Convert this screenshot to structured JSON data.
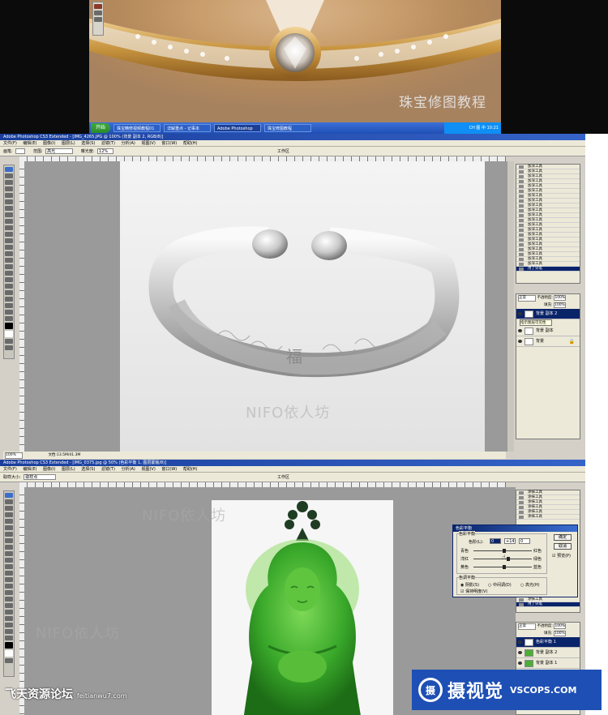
{
  "video": {
    "caption": "珠宝修图教程",
    "start_button": "开始",
    "taskbar_items": [
      "珠宝精修视频教程01",
      "详解重点 - 记事本",
      "Adobe Photoshop",
      "珠宝修图教程"
    ],
    "active_task_index": 2,
    "tray_text": "CH 图 中 10:21"
  },
  "ps1": {
    "title": "Adobe Photoshop CS3 Extended - [IMG_4265.JPG @ 100% (背景 副本 2, RGB/8)]",
    "menu": [
      "文件(F)",
      "编辑(E)",
      "图像(I)",
      "图层(L)",
      "选择(S)",
      "滤镜(T)",
      "分析(A)",
      "视图(V)",
      "窗口(W)",
      "帮助(H)"
    ],
    "options": {
      "brush_label": "画笔:",
      "range_label": "范围:",
      "range_value": "高光",
      "exposure_label": "曝光度:",
      "exposure_value": "12%",
      "workspace": "工作区"
    },
    "watermark": "NIFO依人坊",
    "history_item_label": "加深工具",
    "history_last": "用了尖笔",
    "layers": {
      "mode": "正常",
      "opacity_label": "不透明度:",
      "opacity": "100%",
      "fill_label": "填充:",
      "fill": "100%",
      "rows": [
        "背景 副本 2",
        "背景 副本",
        "背景"
      ],
      "selected": 0,
      "tooltip": "指示图层可见性"
    },
    "status_zoom": "100%",
    "status_doc": "文档:13.5M/41.3M"
  },
  "ps2": {
    "title": "Adobe Photoshop CS3 Extended - [IMG_0375.jpg @ 50% (色彩平衡 1, 图层蒙版/8)]",
    "menu": [
      "文件(F)",
      "编辑(E)",
      "图像(I)",
      "图层(L)",
      "选择(S)",
      "滤镜(T)",
      "分析(A)",
      "视图(V)",
      "窗口(W)",
      "帮助(H)"
    ],
    "options": {
      "sample_label": "取样大小:",
      "sample_value": "取样点",
      "workspace": "工作区"
    },
    "watermark": "NIFO依人坊",
    "history_item_label": "涂抹工具",
    "history_last": "用了尖笔",
    "layers": {
      "mode": "正常",
      "opacity_label": "不透明度:",
      "opacity": "100%",
      "fill_label": "填充:",
      "fill": "100%",
      "rows": [
        "色彩平衡 1",
        "背景 副本 2",
        "背景 副本 1"
      ],
      "selected": 0
    },
    "dialog": {
      "title": "色彩平衡",
      "group_balance": "色彩平衡",
      "levels_label": "色阶(L):",
      "levels": [
        "0",
        "+14",
        "0"
      ],
      "sliders": [
        {
          "left": "青色",
          "right": "红色"
        },
        {
          "left": "洋红",
          "right": "绿色"
        },
        {
          "left": "黄色",
          "right": "蓝色"
        }
      ],
      "slider_positions": [
        0.5,
        0.57,
        0.5
      ],
      "group_tone": "色调平衡",
      "tone": [
        "阴影(S)",
        "中间调(D)",
        "高光(H)"
      ],
      "preserve": "保持明度(V)",
      "ok": "确定",
      "cancel": "取消",
      "preview": "预览(P)"
    }
  },
  "logos": {
    "left_cn": "飞天资源论坛",
    "left_en": "feitianwu7.com",
    "right_glyph": "摄",
    "right_cn": "摄视觉",
    "right_en": "VSCOPS.COM"
  }
}
